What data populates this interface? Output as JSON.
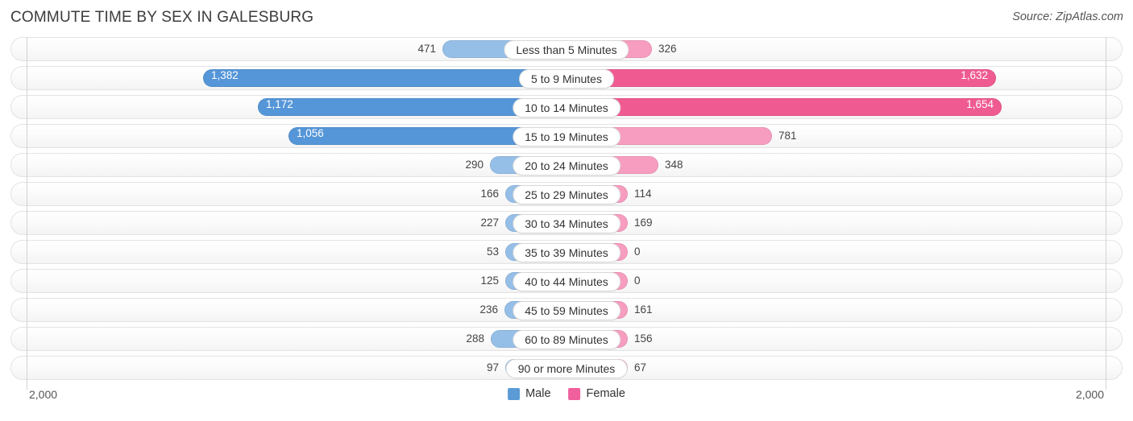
{
  "header": {
    "title": "COMMUTE TIME BY SEX IN GALESBURG",
    "source": "Source: ZipAtlas.com"
  },
  "axis": {
    "left_tick": "2,000",
    "right_tick": "2,000"
  },
  "legend": {
    "items": [
      {
        "label": "Male",
        "color": "#5b9bd5"
      },
      {
        "label": "Female",
        "color": "#f0609c"
      }
    ]
  },
  "colors": {
    "male_strong": "#5596d8",
    "male_light": "#96bfe8",
    "female_strong": "#ef5b91",
    "female_light": "#f79dc0",
    "row_border": "#e3e3e3",
    "axis_line": "#d2d2d2"
  },
  "chart_data": {
    "type": "bar",
    "title": "COMMUTE TIME BY SEX IN GALESBURG",
    "subtitle": "Source: ZipAtlas.com",
    "orientation": "horizontal-diverging",
    "xlabel": "",
    "ylabel": "",
    "xlim": [
      2000,
      2000
    ],
    "axis_max": 2000,
    "grid": false,
    "legend_position": "bottom-center",
    "categories": [
      "Less than 5 Minutes",
      "5 to 9 Minutes",
      "10 to 14 Minutes",
      "15 to 19 Minutes",
      "20 to 24 Minutes",
      "25 to 29 Minutes",
      "30 to 34 Minutes",
      "35 to 39 Minutes",
      "40 to 44 Minutes",
      "45 to 59 Minutes",
      "60 to 89 Minutes",
      "90 or more Minutes"
    ],
    "series": [
      {
        "name": "Male",
        "side": "left",
        "values": [
          471,
          1382,
          1172,
          1056,
          290,
          166,
          227,
          53,
          125,
          236,
          288,
          97
        ],
        "labels": [
          "471",
          "1,382",
          "1,172",
          "1,056",
          "290",
          "166",
          "227",
          "53",
          "125",
          "236",
          "288",
          "97"
        ]
      },
      {
        "name": "Female",
        "side": "right",
        "values": [
          326,
          1632,
          1654,
          781,
          348,
          114,
          169,
          0,
          0,
          161,
          156,
          67
        ],
        "labels": [
          "326",
          "1,632",
          "1,654",
          "781",
          "348",
          "114",
          "169",
          "0",
          "0",
          "161",
          "156",
          "67"
        ]
      }
    ]
  }
}
